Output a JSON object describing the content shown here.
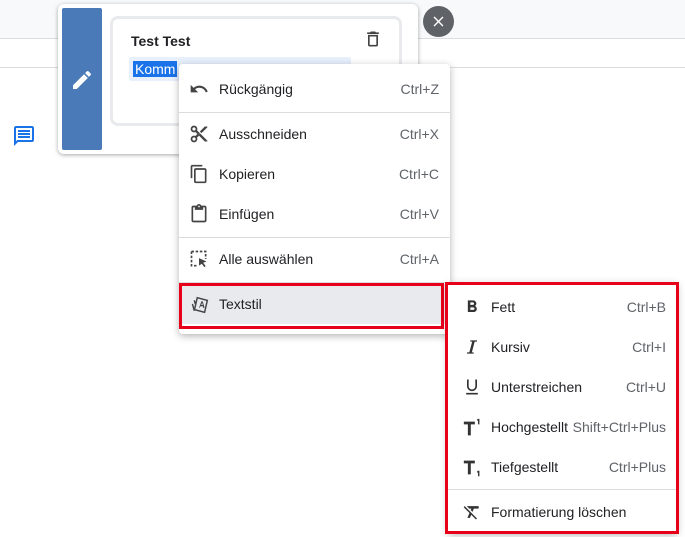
{
  "comment": {
    "author": "Test Test",
    "input_value": "Komm"
  },
  "context_menu": {
    "items": [
      {
        "label": "Rückgängig",
        "shortcut": "Ctrl+Z",
        "icon": "undo-icon"
      },
      {
        "label": "Ausschneiden",
        "shortcut": "Ctrl+X",
        "icon": "cut-icon"
      },
      {
        "label": "Kopieren",
        "shortcut": "Ctrl+C",
        "icon": "copy-icon"
      },
      {
        "label": "Einfügen",
        "shortcut": "Ctrl+V",
        "icon": "paste-icon"
      },
      {
        "label": "Alle auswählen",
        "shortcut": "Ctrl+A",
        "icon": "select-all-icon"
      },
      {
        "label": "Textstil",
        "shortcut": "",
        "icon": "text-style-icon"
      }
    ]
  },
  "submenu": {
    "items": [
      {
        "label": "Fett",
        "shortcut": "Ctrl+B",
        "icon": "bold-icon"
      },
      {
        "label": "Kursiv",
        "shortcut": "Ctrl+I",
        "icon": "italic-icon"
      },
      {
        "label": "Unterstreichen",
        "shortcut": "Ctrl+U",
        "icon": "underline-icon"
      },
      {
        "label": "Hochgestellt",
        "shortcut": "Shift+Ctrl+Plus",
        "icon": "superscript-icon"
      },
      {
        "label": "Tiefgestellt",
        "shortcut": "Ctrl+Plus",
        "icon": "subscript-icon"
      },
      {
        "label": "Formatierung löschen",
        "shortcut": "",
        "icon": "clear-formatting-icon"
      }
    ]
  },
  "colors": {
    "highlight": "#e8001a",
    "accent": "#4a7ab8",
    "selection": "#1a73e8"
  }
}
